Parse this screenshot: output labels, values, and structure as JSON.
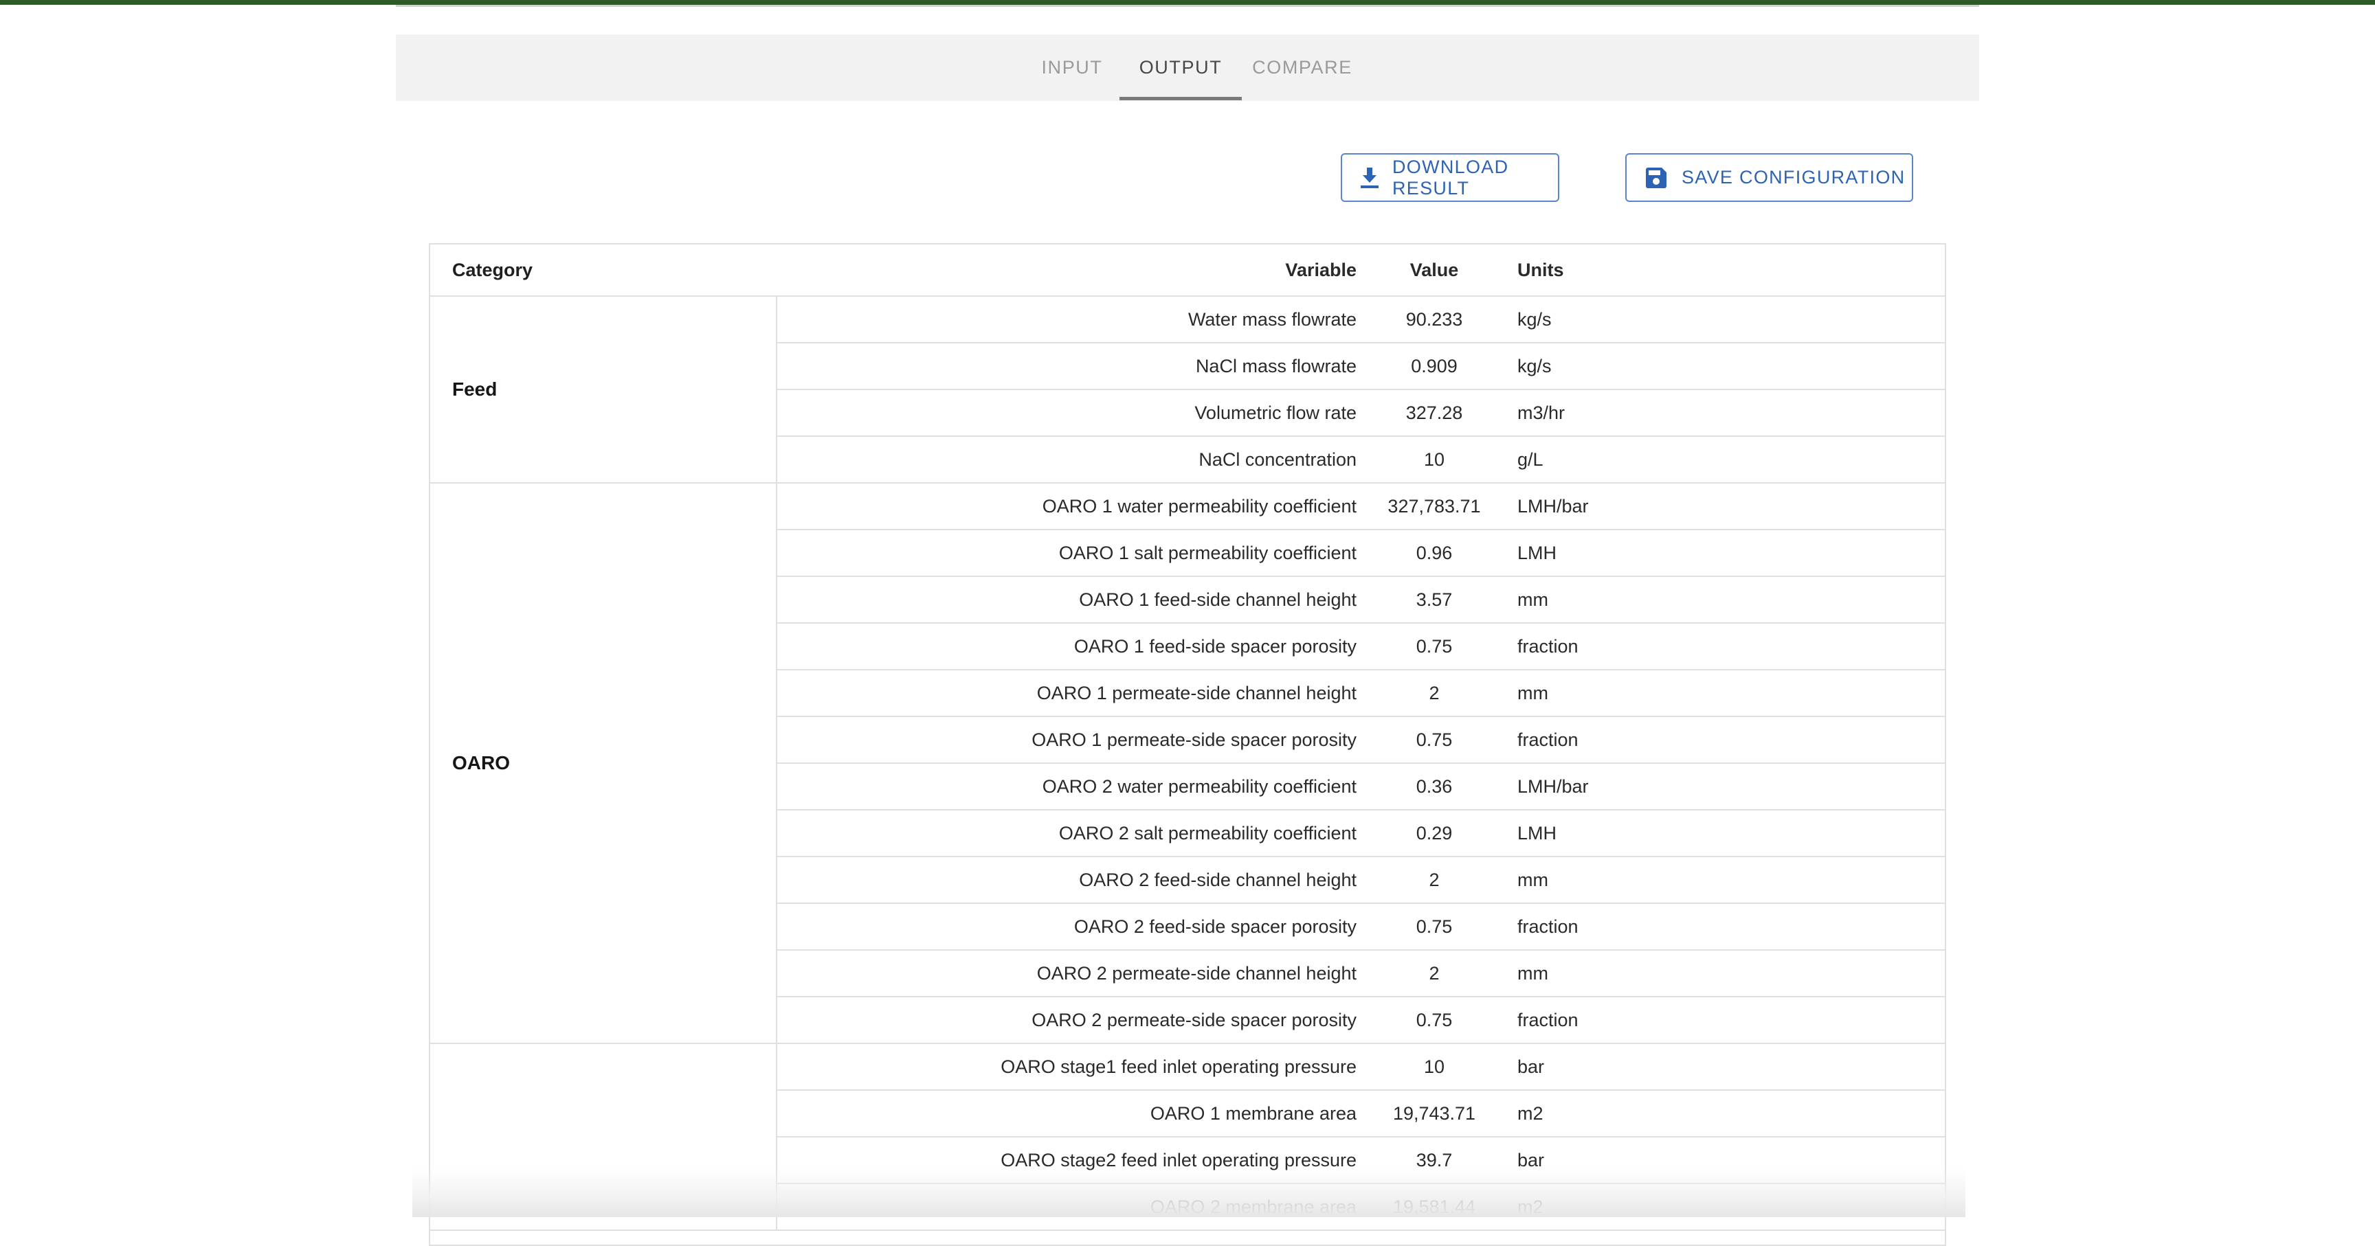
{
  "tabs": [
    {
      "label": "INPUT",
      "active": false
    },
    {
      "label": "OUTPUT",
      "active": true
    },
    {
      "label": "COMPARE",
      "active": false
    }
  ],
  "actions": {
    "download_label": "DOWNLOAD RESULT",
    "download_icon": "download-icon",
    "save_label": "SAVE CONFIGURATION",
    "save_icon": "floppy-disk-icon"
  },
  "table": {
    "headers": {
      "category": "Category",
      "variable": "Variable",
      "value": "Value",
      "units": "Units"
    },
    "groups": [
      {
        "category": "Feed",
        "rows": [
          {
            "variable": "Water mass flowrate",
            "value": "90.233",
            "units": "kg/s"
          },
          {
            "variable": "NaCl mass flowrate",
            "value": "0.909",
            "units": "kg/s"
          },
          {
            "variable": "Volumetric flow rate",
            "value": "327.28",
            "units": "m3/hr"
          },
          {
            "variable": "NaCl concentration",
            "value": "10",
            "units": "g/L"
          }
        ]
      },
      {
        "category": "OARO",
        "rows": [
          {
            "variable": "OARO 1 water permeability coefficient",
            "value": "327,783.71",
            "units": "LMH/bar"
          },
          {
            "variable": "OARO 1 salt permeability coefficient",
            "value": "0.96",
            "units": "LMH"
          },
          {
            "variable": "OARO 1 feed-side channel height",
            "value": "3.57",
            "units": "mm"
          },
          {
            "variable": "OARO 1 feed-side spacer porosity",
            "value": "0.75",
            "units": "fraction"
          },
          {
            "variable": "OARO 1 permeate-side channel height",
            "value": "2",
            "units": "mm"
          },
          {
            "variable": "OARO 1 permeate-side spacer porosity",
            "value": "0.75",
            "units": "fraction"
          },
          {
            "variable": "OARO 2 water permeability coefficient",
            "value": "0.36",
            "units": "LMH/bar"
          },
          {
            "variable": "OARO 2 salt permeability coefficient",
            "value": "0.29",
            "units": "LMH"
          },
          {
            "variable": "OARO 2 feed-side channel height",
            "value": "2",
            "units": "mm"
          },
          {
            "variable": "OARO 2 feed-side spacer porosity",
            "value": "0.75",
            "units": "fraction"
          },
          {
            "variable": "OARO 2 permeate-side channel height",
            "value": "2",
            "units": "mm"
          },
          {
            "variable": "OARO 2 permeate-side spacer porosity",
            "value": "0.75",
            "units": "fraction"
          }
        ]
      },
      {
        "category": "",
        "rows": [
          {
            "variable": "OARO stage1 feed inlet operating pressure",
            "value": "10",
            "units": "bar"
          },
          {
            "variable": "OARO 1 membrane area",
            "value": "19,743.71",
            "units": "m2"
          },
          {
            "variable": "OARO stage2 feed inlet operating pressure",
            "value": "39.7",
            "units": "bar"
          },
          {
            "variable": "OARO 2 membrane area",
            "value": "19,581.44",
            "units": "m2"
          }
        ]
      }
    ]
  }
}
